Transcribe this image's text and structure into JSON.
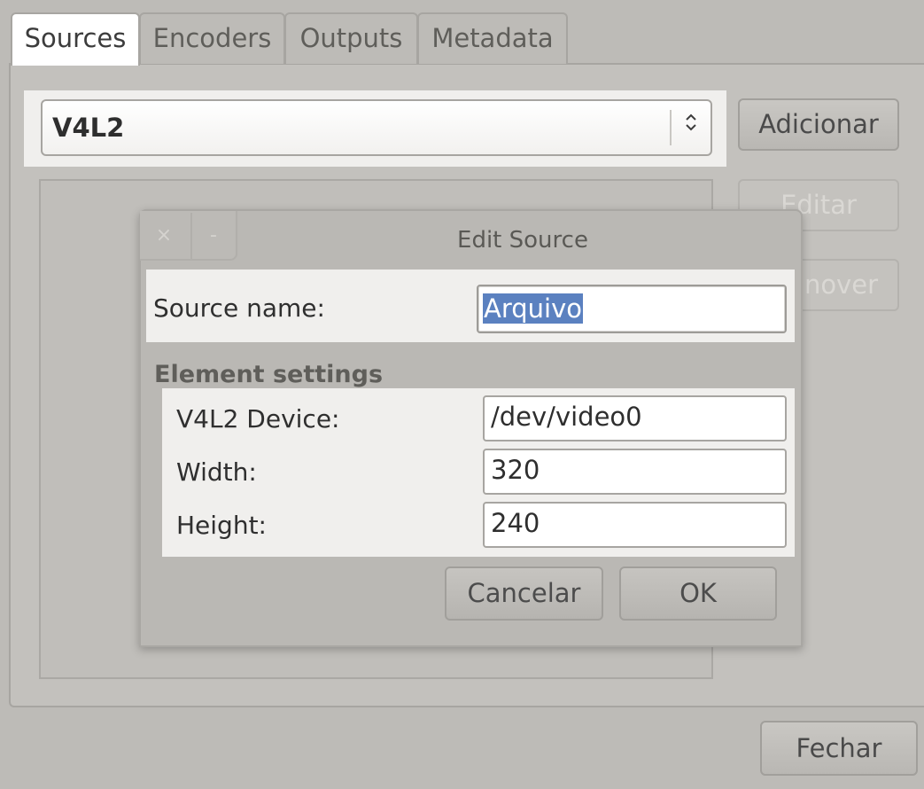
{
  "tabs": [
    {
      "label": "Sources",
      "active": true
    },
    {
      "label": "Encoders",
      "active": false
    },
    {
      "label": "Outputs",
      "active": false
    },
    {
      "label": "Metadata",
      "active": false
    }
  ],
  "source_selector": {
    "selected": "V4L2",
    "arrow_glyph": "⌃⌄"
  },
  "side_buttons": {
    "add": "Adicionar",
    "edit": "Editar",
    "remove": "Remover",
    "edit_visible": "Editar",
    "remove_visible": "nover"
  },
  "footer": {
    "close": "Fechar"
  },
  "dialog": {
    "title": "Edit Source",
    "close_glyph": "×",
    "minimize_glyph": "-",
    "source_name_label": "Source name:",
    "source_name_value": "Arquivo",
    "section_title": "Element settings",
    "fields": [
      {
        "label": "V4L2 Device:",
        "value": "/dev/video0"
      },
      {
        "label": "Width:",
        "value": "320"
      },
      {
        "label": "Height:",
        "value": "240"
      }
    ],
    "cancel": "Cancelar",
    "ok": "OK"
  },
  "colors": {
    "background": "#bdbbb7",
    "highlight": "#f0efed",
    "selection": "#5b81c0"
  }
}
